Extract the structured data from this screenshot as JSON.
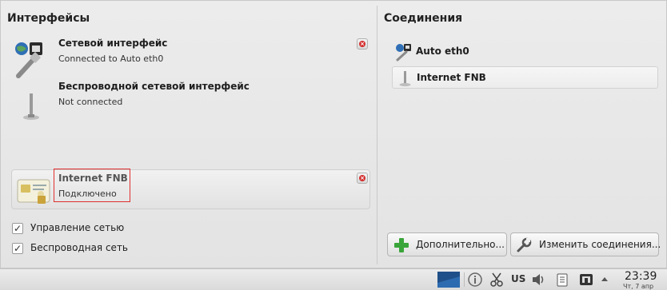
{
  "interfaces": {
    "title": "Интерфейсы",
    "items": [
      {
        "name": "Сетевой интерфейс",
        "status": "Connected to Auto eth0"
      },
      {
        "name": "Беспроводной сетевой интерфейс",
        "status": "Not connected"
      }
    ],
    "active": {
      "name": "Internet FNB",
      "status": "Подключено"
    },
    "checkboxes": [
      {
        "label": "Управление сетью",
        "checked": true
      },
      {
        "label": "Беспроводная сеть",
        "checked": true
      }
    ]
  },
  "connections": {
    "title": "Соединения",
    "items": [
      {
        "label": "Auto eth0",
        "icon": "wired-network-icon"
      },
      {
        "label": "Internet FNB",
        "icon": "mobile-broadband-icon"
      }
    ],
    "buttons": {
      "more": "Дополнительно...",
      "edit": "Изменить соединения..."
    }
  },
  "taskbar": {
    "keyboard_layout": "US",
    "time": "23:39",
    "date": "Чт, 7 апр"
  },
  "colors": {
    "close": "#d32f2f",
    "highlight": "#e03030",
    "add_green": "#3aa53a"
  }
}
